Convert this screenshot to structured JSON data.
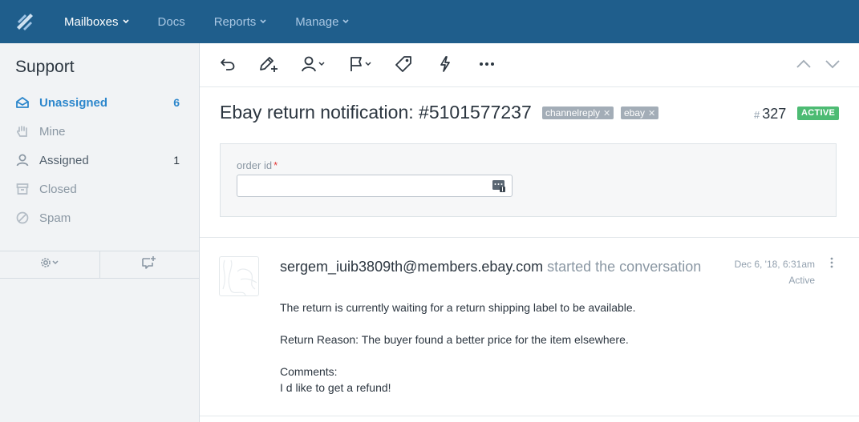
{
  "nav": {
    "items": [
      {
        "label": "Mailboxes",
        "has_menu": true,
        "active": true
      },
      {
        "label": "Docs",
        "has_menu": false,
        "active": false
      },
      {
        "label": "Reports",
        "has_menu": true,
        "active": false
      },
      {
        "label": "Manage",
        "has_menu": true,
        "active": false
      }
    ]
  },
  "sidebar": {
    "title": "Support",
    "items": [
      {
        "label": "Unassigned",
        "count": "6",
        "icon": "inbox-icon",
        "selected": true
      },
      {
        "label": "Mine",
        "count": "",
        "icon": "hand-icon",
        "selected": false
      },
      {
        "label": "Assigned",
        "count": "1",
        "icon": "user-icon",
        "selected": false
      },
      {
        "label": "Closed",
        "count": "",
        "icon": "archive-icon",
        "selected": false
      },
      {
        "label": "Spam",
        "count": "",
        "icon": "block-icon",
        "selected": false
      }
    ],
    "footer": [
      "gear-icon",
      "new-conversation-icon"
    ]
  },
  "toolbar": {
    "actions": [
      "reply-icon",
      "note-icon",
      "assign-icon",
      "flag-icon",
      "tag-icon",
      "workflow-icon",
      "more-icon"
    ],
    "navigation": [
      "prev-icon",
      "next-icon"
    ]
  },
  "conversation": {
    "title": "Ebay return notification: #5101577237",
    "tags": [
      "channelreply",
      "ebay"
    ],
    "number_prefix": "#",
    "number": "327",
    "status": "ACTIVE",
    "custom_field": {
      "label": "order id",
      "required_mark": "*",
      "value": ""
    }
  },
  "thread": {
    "author": "sergem_iuib3809th@members.ebay.com",
    "action": "started the conversation",
    "date": "Dec 6, '18, 6:31am",
    "status": "Active",
    "lines": [
      "The return is currently waiting for a return shipping label to be available.",
      "Return Reason: The buyer found a better price for the item elsewhere.",
      "Comments:",
      "I d like to get a refund!"
    ]
  },
  "colors": {
    "nav_bg": "#1f5e8c",
    "accent": "#2d87cc",
    "active_badge": "#4dbb73",
    "tag_bg": "#a3adb7"
  }
}
